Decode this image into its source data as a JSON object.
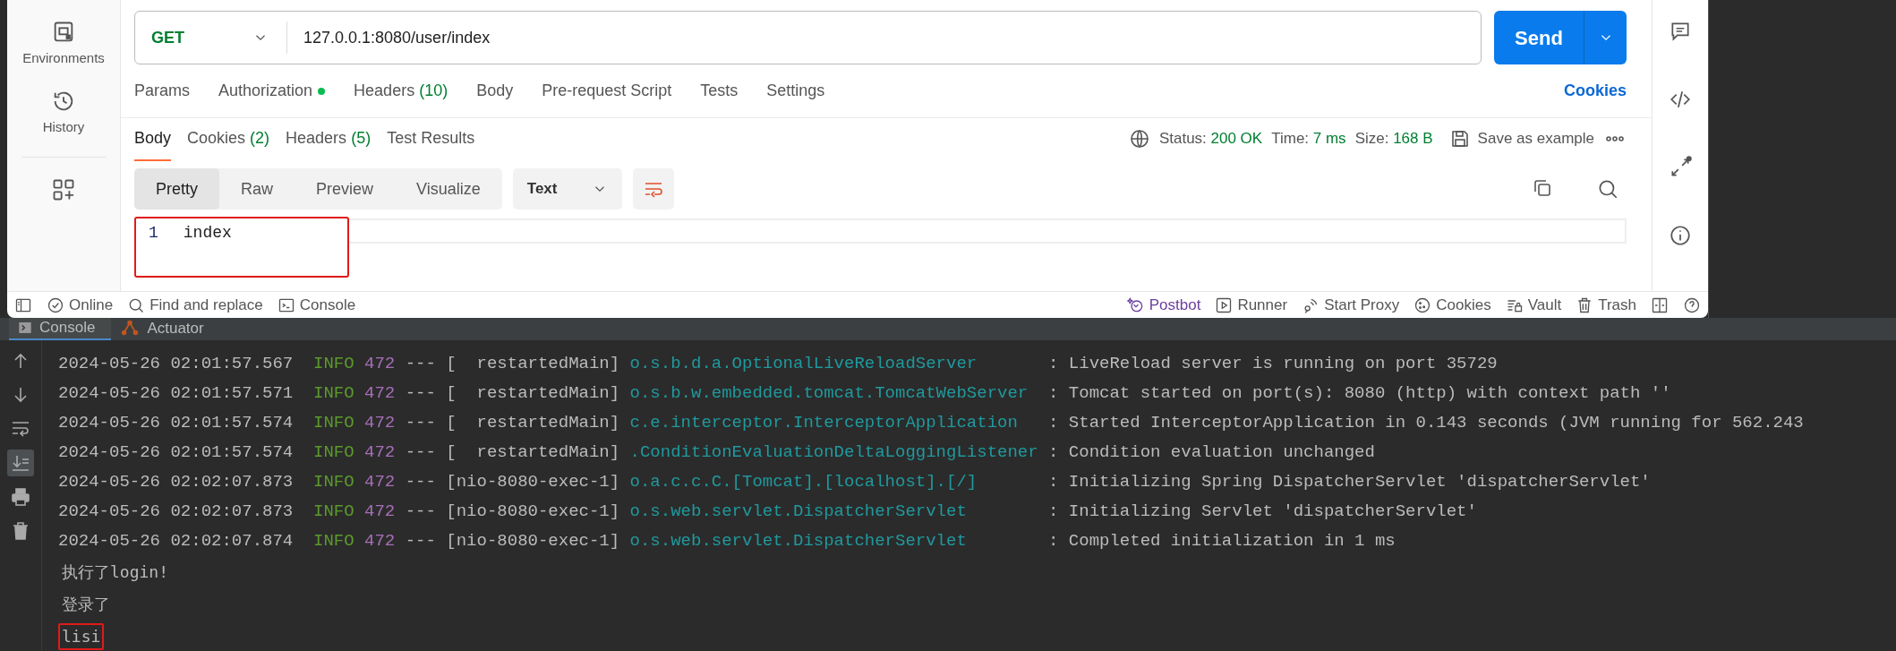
{
  "sidebar": {
    "items": [
      {
        "label": "Environments"
      },
      {
        "label": "History"
      }
    ]
  },
  "request": {
    "method": "GET",
    "url": "127.0.0.1:8080/user/index",
    "send": "Send"
  },
  "request_tabs": [
    {
      "label": "Params"
    },
    {
      "label": "Authorization",
      "dot": true
    },
    {
      "label": "Headers",
      "count": "(10)"
    },
    {
      "label": "Body"
    },
    {
      "label": "Pre-request Script"
    },
    {
      "label": "Tests"
    },
    {
      "label": "Settings"
    }
  ],
  "cookies_link": "Cookies",
  "response_tabs": [
    {
      "label": "Body",
      "selected": true
    },
    {
      "label": "Cookies",
      "count": "(2)",
      "selected": false
    },
    {
      "label": "Headers",
      "count": "(5)",
      "selected": false
    },
    {
      "label": "Test Results",
      "selected": false
    }
  ],
  "response_meta": {
    "status_label": "Status:",
    "status": "200 OK",
    "time_label": "Time:",
    "time": "7 ms",
    "size_label": "Size:",
    "size": "168 B",
    "save": "Save as example"
  },
  "view_modes": [
    {
      "label": "Pretty",
      "selected": true
    },
    {
      "label": "Raw",
      "selected": false
    },
    {
      "label": "Preview",
      "selected": false
    },
    {
      "label": "Visualize",
      "selected": false
    }
  ],
  "format": "Text",
  "body_lines": [
    {
      "number": "1",
      "text": "index",
      "highlighted": true
    }
  ],
  "status_bar": {
    "left": [
      {
        "label": "Online"
      },
      {
        "label": "Find and replace"
      },
      {
        "label": "Console"
      }
    ],
    "right": [
      {
        "label": "Postbot"
      },
      {
        "label": "Runner"
      },
      {
        "label": "Start Proxy"
      },
      {
        "label": "Cookies"
      },
      {
        "label": "Vault"
      },
      {
        "label": "Trash"
      }
    ]
  },
  "console_tabs": [
    {
      "label": "Console",
      "selected": true
    },
    {
      "label": "Actuator",
      "selected": false
    }
  ],
  "log_lines": [
    {
      "time": "2024-05-26 02:01:57.567",
      "level": "INFO",
      "pid": "472",
      "sep": "---",
      "thread": "[  restartedMain]",
      "logger": "o.s.b.d.a.OptionalLiveReloadServer",
      "message": ": LiveReload server is running on port 35729"
    },
    {
      "time": "2024-05-26 02:01:57.571",
      "level": "INFO",
      "pid": "472",
      "sep": "---",
      "thread": "[  restartedMain]",
      "logger": "o.s.b.w.embedded.tomcat.TomcatWebServer",
      "message": ": Tomcat started on port(s): 8080 (http) with context path ''"
    },
    {
      "time": "2024-05-26 02:01:57.574",
      "level": "INFO",
      "pid": "472",
      "sep": "---",
      "thread": "[  restartedMain]",
      "logger": "c.e.interceptor.InterceptorApplication",
      "message": ": Started InterceptorApplication in 0.143 seconds (JVM running for 562.243"
    },
    {
      "time": "2024-05-26 02:01:57.574",
      "level": "INFO",
      "pid": "472",
      "sep": "---",
      "thread": "[  restartedMain]",
      "logger": ".ConditionEvaluationDeltaLoggingListener",
      "message": ": Condition evaluation unchanged"
    },
    {
      "time": "2024-05-26 02:02:07.873",
      "level": "INFO",
      "pid": "472",
      "sep": "---",
      "thread": "[nio-8080-exec-1]",
      "logger": "o.a.c.c.C.[Tomcat].[localhost].[/]",
      "message": ": Initializing Spring DispatcherServlet 'dispatcherServlet'"
    },
    {
      "time": "2024-05-26 02:02:07.873",
      "level": "INFO",
      "pid": "472",
      "sep": "---",
      "thread": "[nio-8080-exec-1]",
      "logger": "o.s.web.servlet.DispatcherServlet",
      "message": ": Initializing Servlet 'dispatcherServlet'"
    },
    {
      "time": "2024-05-26 02:02:07.874",
      "level": "INFO",
      "pid": "472",
      "sep": "---",
      "thread": "[nio-8080-exec-1]",
      "logger": "o.s.web.servlet.DispatcherServlet",
      "message": ": Completed initialization in 1 ms"
    }
  ],
  "output_lines": [
    {
      "text": "执行了login!",
      "highlighted": false
    },
    {
      "text": "登录了",
      "highlighted": false
    },
    {
      "text": "lisi",
      "highlighted": true
    }
  ]
}
